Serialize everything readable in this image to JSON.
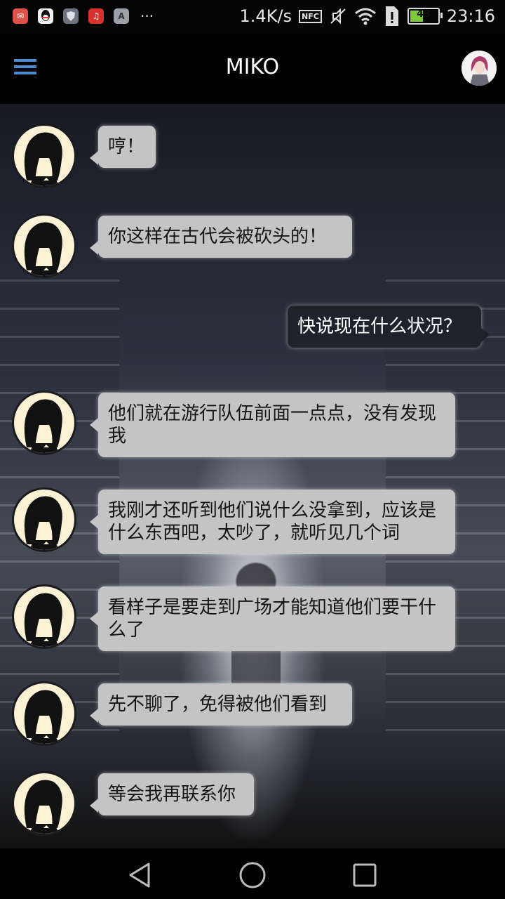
{
  "status_bar": {
    "net_speed": "1.4K/s",
    "nfc_label": "NFC",
    "battery": "43",
    "time": "23:16",
    "overflow": "···"
  },
  "app_bar": {
    "title": "MIKO"
  },
  "messages": [
    {
      "from": "miko",
      "text": "哼！"
    },
    {
      "from": "miko",
      "text": "你这样在古代会被砍头的！"
    },
    {
      "from": "me",
      "text": "快说现在什么状况？"
    },
    {
      "from": "miko",
      "text": "他们就在游行队伍前面一点点，没有发现我"
    },
    {
      "from": "miko",
      "text": "我刚才还听到他们说什么没拿到，应该是什么东西吧，太吵了，就听见几个词"
    },
    {
      "from": "miko",
      "text": "看样子是要走到广场才能知道他们要干什么了"
    },
    {
      "from": "miko",
      "text": "先不聊了，免得被他们看到"
    },
    {
      "from": "miko",
      "text": "等会我再联系你"
    }
  ]
}
